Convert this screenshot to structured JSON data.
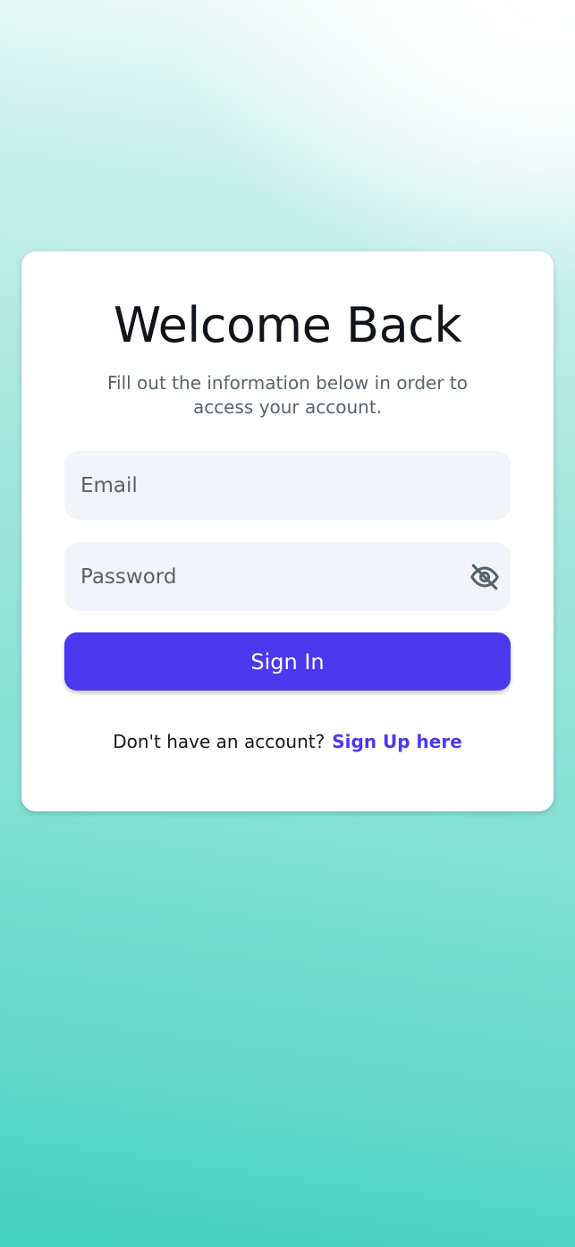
{
  "card": {
    "title": "Welcome Back",
    "subtitle": "Fill out the information below in order to access your account."
  },
  "form": {
    "email": {
      "value": "",
      "placeholder": "Email"
    },
    "password": {
      "value": "",
      "placeholder": "Password",
      "toggle_icon": "eye-off-icon"
    },
    "submit_label": "Sign In"
  },
  "footer": {
    "prompt": "Don't have an account?",
    "link_label": "Sign Up here"
  },
  "colors": {
    "primary": "#4b39ef",
    "field_background": "#f1f4f8",
    "primary_text": "#14181b",
    "secondary_text": "#57636c",
    "background_bottom": "#43d2c0"
  }
}
